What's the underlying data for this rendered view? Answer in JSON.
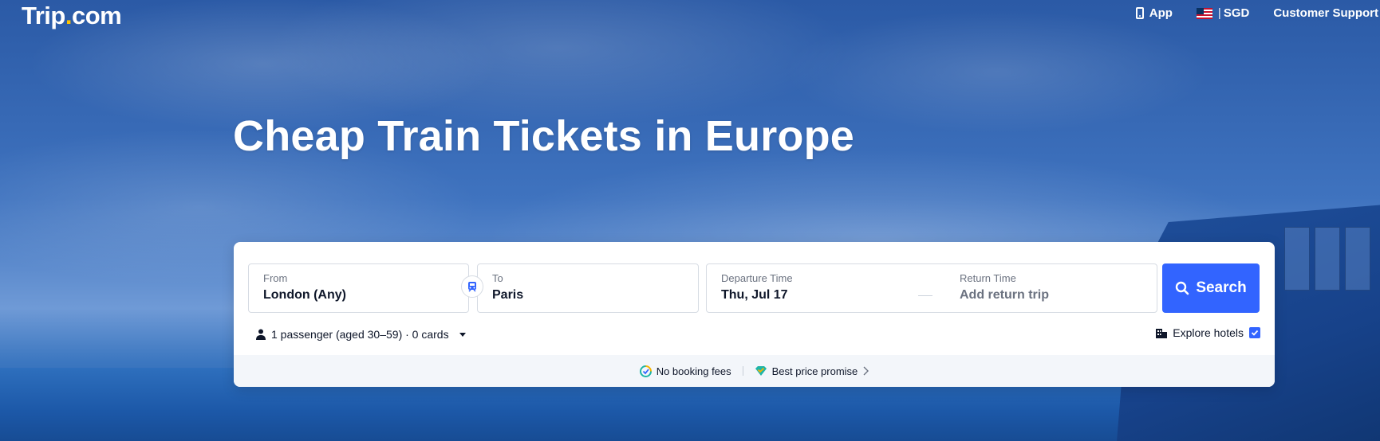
{
  "brand": {
    "logo_main": "Trip",
    "logo_dot": ".",
    "logo_tld": "com",
    "accent": "#3264ff",
    "logo_dot_color": "#ffc300"
  },
  "topnav": {
    "app_label": "App",
    "currency_sep": "|",
    "currency_label": "SGD",
    "support_label": "Customer Support",
    "app_icon": "phone-icon",
    "flag_icon": "us-flag-icon"
  },
  "hero": {
    "title": "Cheap Train Tickets in Europe"
  },
  "search": {
    "from_label": "From",
    "from_value": "London (Any)",
    "to_label": "To",
    "to_value": "Paris",
    "departure_label": "Departure Time",
    "departure_value": "Thu, Jul 17",
    "return_label": "Return Time",
    "return_placeholder": "Add return trip",
    "search_button": "Search",
    "passengers": "1 passenger (aged 30–59) · 0 cards",
    "explore_hotels": "Explore hotels",
    "explore_hotels_checked": true
  },
  "promises": {
    "no_fees": "No booking fees",
    "best_price": "Best price promise"
  }
}
